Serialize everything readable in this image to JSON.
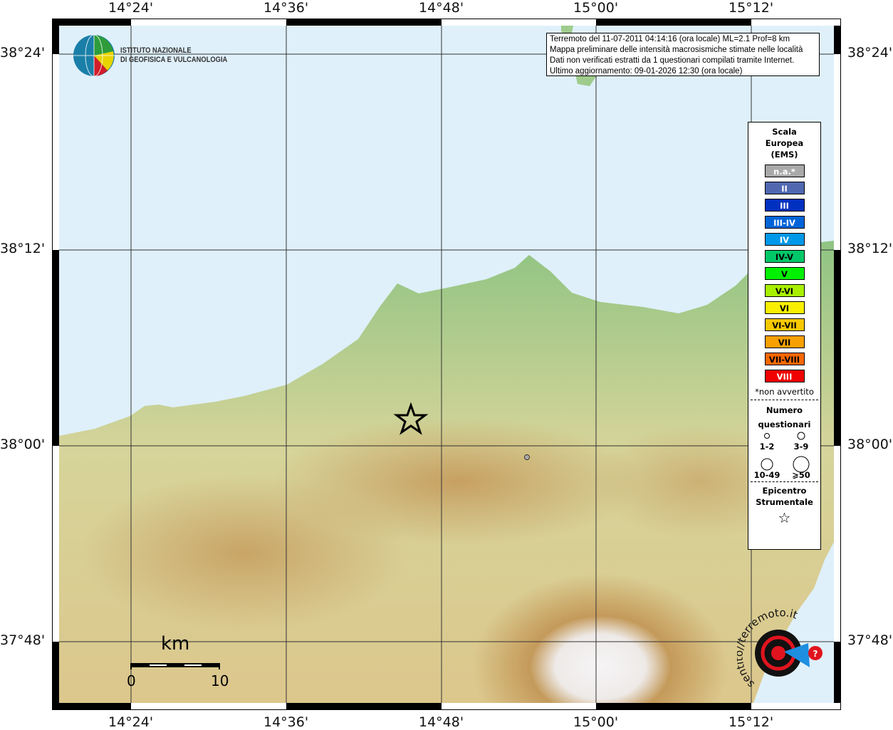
{
  "axes": {
    "lon_labels": [
      "14°24'",
      "14°36'",
      "14°48'",
      "15°00'",
      "15°12'"
    ],
    "lat_labels": [
      "38°24'",
      "38°12'",
      "38°00'",
      "37°48'"
    ]
  },
  "logo_ingv": {
    "line1": "ISTITUTO NAZIONALE",
    "line2": "DI GEOFISICA E VULCANOLOGIA"
  },
  "logo_hsit": {
    "text": "www.haisentito//terremoto.it"
  },
  "info": {
    "lines": [
      "Terremoto del 11-07-2011 04:14:16 (ora locale) ML=2.1 Prof=8 km",
      "Mappa preliminare delle intensità macrosismiche stimate nelle località",
      "Dati non verificati estratti da 1 questionari compilati tramite Internet.",
      "Ultimo aggiornamento: 09-01-2026 12:30 (ora locale)"
    ]
  },
  "legend": {
    "title": [
      "Scala",
      "Europea",
      "(EMS)"
    ],
    "scale": [
      {
        "label": "n.a.*",
        "color": "#a9a9a9"
      },
      {
        "label": "II",
        "color": "#5068b0"
      },
      {
        "label": "III",
        "color": "#0030c0"
      },
      {
        "label": "III-IV",
        "color": "#0064d8"
      },
      {
        "label": "IV",
        "color": "#0098e8"
      },
      {
        "label": "IV-V",
        "color": "#00c868"
      },
      {
        "label": "V",
        "color": "#00f000"
      },
      {
        "label": "V-VI",
        "color": "#a8f000"
      },
      {
        "label": "VI",
        "color": "#f8f000"
      },
      {
        "label": "VI-VII",
        "color": "#f8c800"
      },
      {
        "label": "VII",
        "color": "#f8a000"
      },
      {
        "label": "VII-VIII",
        "color": "#f86800"
      },
      {
        "label": "VIII",
        "color": "#f00000"
      }
    ],
    "note": "*non avvertito",
    "count_title": [
      "Numero",
      "questionari"
    ],
    "counts": [
      "1-2",
      "3-9",
      "10-49",
      "⩾50"
    ],
    "epicenter_title": [
      "Epicentro",
      "Strumentale"
    ],
    "epicenter_symbol": "☆"
  },
  "scalebar": {
    "unit": "km",
    "start": "0",
    "end": "10"
  },
  "colors": {
    "sea": "#dff0fb",
    "land": "#c9d79a"
  }
}
